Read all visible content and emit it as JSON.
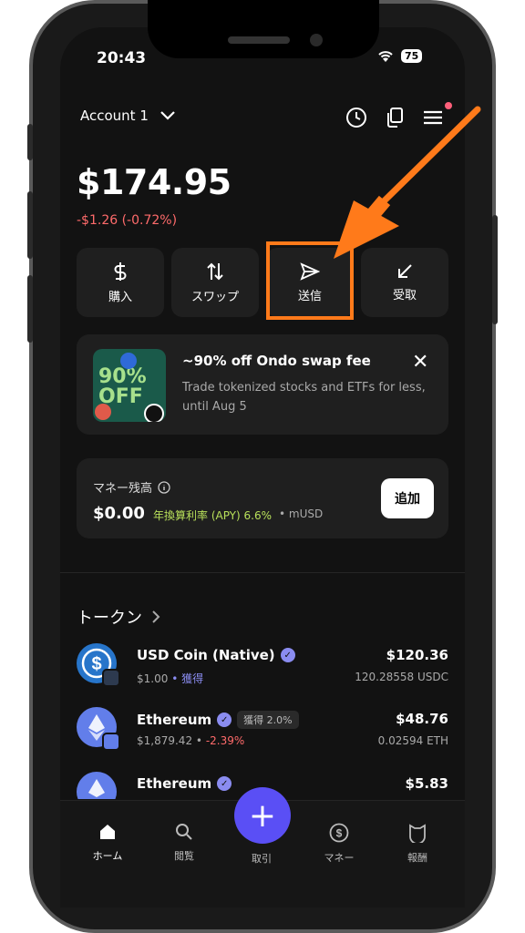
{
  "status": {
    "time": "20:43",
    "battery": "75"
  },
  "header": {
    "account": "Account 1"
  },
  "wallet": {
    "balance": "$174.95",
    "change": "-$1.26 (-0.72%)"
  },
  "actions": [
    {
      "label": "購入",
      "icon": "dollar-icon"
    },
    {
      "label": "スワップ",
      "icon": "swap-icon"
    },
    {
      "label": "送信",
      "icon": "send-icon"
    },
    {
      "label": "受取",
      "icon": "receive-icon"
    }
  ],
  "promo": {
    "image_text": "90% OFF",
    "title": "~90% off Ondo swap fee",
    "description": "Trade tokenized stocks and ETFs for less, until Aug 5"
  },
  "money": {
    "label": "マネー残高",
    "amount": "$0.00",
    "apy": "年換算利率 (APY) 6.6%",
    "sub": "• mUSD",
    "add_label": "追加"
  },
  "tokens": {
    "heading": "トークン",
    "items": [
      {
        "name": "USD Coin (Native)",
        "price": "$1.00",
        "sub_extra": "• 獲得",
        "value": "$120.36",
        "qty": "120.28558 USDC"
      },
      {
        "name": "Ethereum",
        "chip": "獲得 2.0%",
        "price": "$1,879.42",
        "sub_sep": "•",
        "change": "-2.39%",
        "value": "$48.76",
        "qty": "0.02594 ETH"
      },
      {
        "name": "Ethereum",
        "value": "$5.83"
      }
    ]
  },
  "nav": {
    "items": [
      "ホーム",
      "閲覧",
      "取引",
      "マネー",
      "報酬"
    ]
  },
  "colors": {
    "accent": "#5a4ff5",
    "highlight": "#ff7a1a",
    "negative": "#ff6b6b",
    "apy": "#b8e05a"
  }
}
